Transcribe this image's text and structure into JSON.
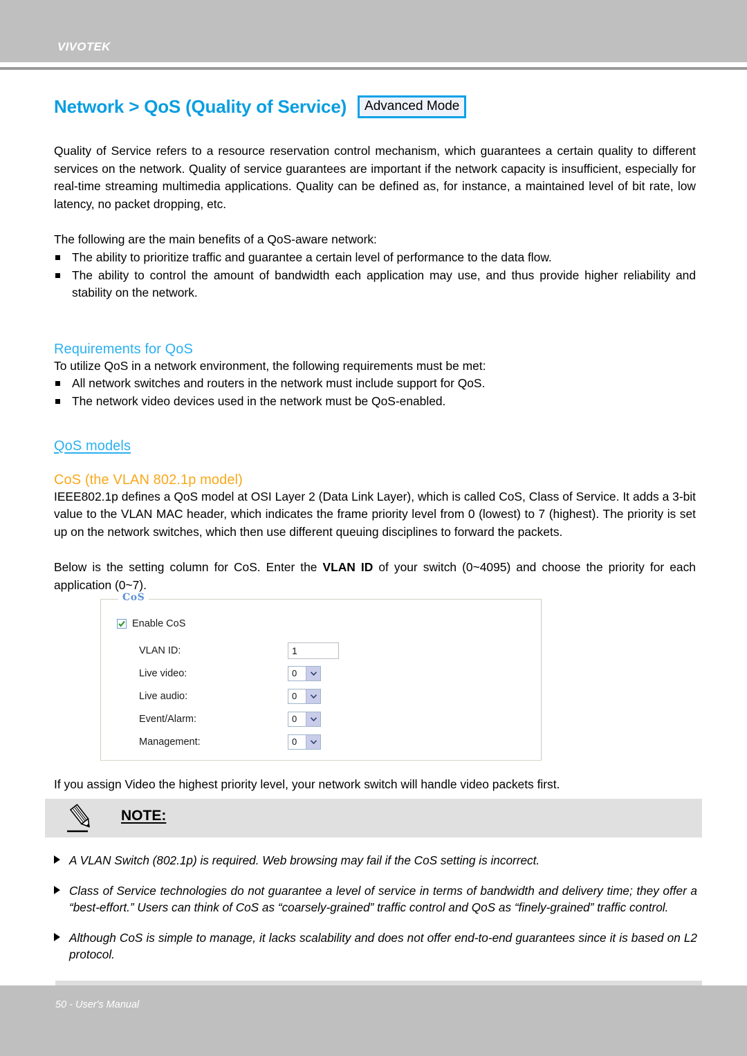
{
  "header": {
    "brand": "VIVOTEK"
  },
  "title": {
    "text": "Network > QoS (Quality of Service)",
    "badge": "Advanced Mode",
    "color": "#0a9ee0",
    "badge_border_color": "#06a2e8"
  },
  "intro": {
    "paragraph": "Quality of Service refers to a resource reservation control mechanism, which guarantees a certain quality to different services on the network. Quality of service guarantees are important if the network capacity is insufficient, especially for real-time streaming multimedia applications. Quality can be defined as, for instance, a maintained level of bit rate, low latency, no packet dropping, etc.",
    "benefits_lead": "The following are the main benefits of a QoS-aware network:",
    "benefits": [
      "The ability to prioritize traffic and guarantee a certain level of performance to the data flow.",
      "The ability to control the amount of bandwidth each application may use, and thus provide higher reliability and stability on the network."
    ]
  },
  "requirements": {
    "heading": "Requirements for QoS",
    "lead": "To utilize QoS in a network environment, the following requirements must be met:",
    "items": [
      "All network switches and routers in the network must include support for QoS.",
      "The network video devices used in the network must be QoS-enabled."
    ]
  },
  "models": {
    "heading": "QoS models",
    "cos_heading": "CoS (the VLAN 802.1p model)",
    "cos_heading_color": "#f7a81b",
    "cos_paragraph": "IEEE802.1p defines a QoS model at OSI Layer 2 (Data Link Layer), which is called CoS, Class of Service. It adds a 3-bit value to the VLAN MAC header, which indicates the frame priority level from 0 (lowest) to 7 (highest). The priority is set up on the network switches, which then use different queuing disciplines to forward the packets.",
    "setting_intro_a": "Below is the setting column for CoS. Enter the ",
    "setting_intro_bold": "VLAN ID",
    "setting_intro_b": " of your switch (0~4095) and choose the priority for each application (0~7)."
  },
  "cos_panel": {
    "legend": "CoS",
    "enable_label": "Enable CoS",
    "enable_checked": true,
    "fields": [
      {
        "label": "VLAN ID:",
        "type": "text",
        "value": "1"
      },
      {
        "label": "Live video:",
        "type": "select",
        "value": "0"
      },
      {
        "label": "Live audio:",
        "type": "select",
        "value": "0"
      },
      {
        "label": "Event/Alarm:",
        "type": "select",
        "value": "0"
      },
      {
        "label": "Management:",
        "type": "select",
        "value": "0"
      }
    ]
  },
  "after_panel": {
    "paragraph": "If you assign Video the highest priority level, your network switch will handle video packets first."
  },
  "note": {
    "title": "NOTE:",
    "band_color": "#e0e0e0",
    "items": [
      "A VLAN Switch (802.1p) is required. Web browsing may fail if the CoS setting is incorrect.",
      "Class of Service technologies do not guarantee a level of service in terms of bandwidth and delivery time; they offer a “best-effort.” Users can think of CoS as “coarsely-grained” traffic control and QoS as “finely-grained” traffic control.",
      "Although CoS is simple to manage, it lacks scalability and does not offer end-to-end guarantees since it is based on L2 protocol."
    ]
  },
  "footer": {
    "text": "50 - User's Manual"
  }
}
